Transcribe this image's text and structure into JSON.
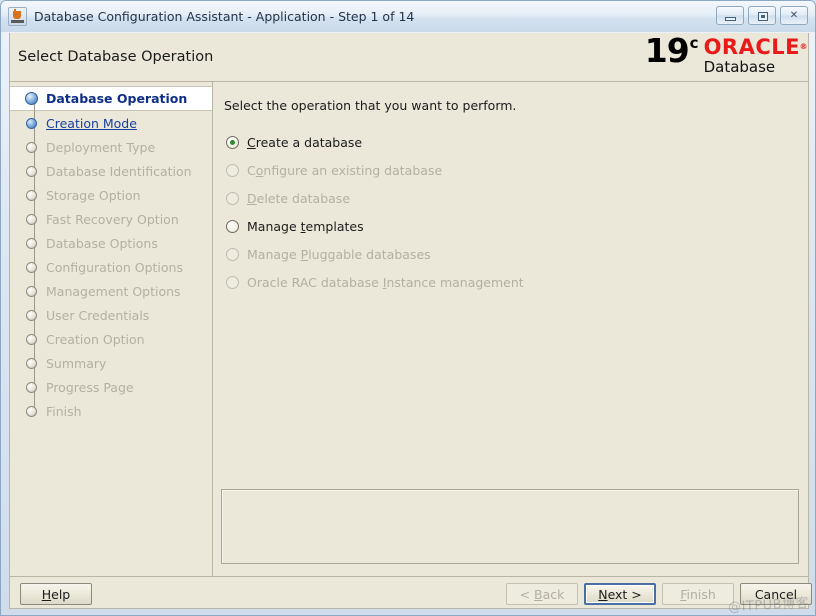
{
  "window": {
    "title": "Database Configuration Assistant - Application - Step 1 of 14",
    "icon": "java-app-icon",
    "buttons": {
      "minimize": "minimize-button",
      "maximize": "maximize-button",
      "close": "✕"
    }
  },
  "header": {
    "title": "Select Database Operation",
    "logo": {
      "version": "19",
      "version_suffix": "c",
      "brand": "ORACLE",
      "product": "Database",
      "brand_color": "#e81a1a"
    }
  },
  "sidebar": {
    "items": [
      {
        "label": "Database Operation",
        "state": "active"
      },
      {
        "label": "Creation Mode",
        "state": "visited"
      },
      {
        "label": "Deployment Type",
        "state": "disabled"
      },
      {
        "label": "Database Identification",
        "state": "disabled"
      },
      {
        "label": "Storage Option",
        "state": "disabled"
      },
      {
        "label": "Fast Recovery Option",
        "state": "disabled"
      },
      {
        "label": "Database Options",
        "state": "disabled"
      },
      {
        "label": "Configuration Options",
        "state": "disabled"
      },
      {
        "label": "Management Options",
        "state": "disabled"
      },
      {
        "label": "User Credentials",
        "state": "disabled"
      },
      {
        "label": "Creation Option",
        "state": "disabled"
      },
      {
        "label": "Summary",
        "state": "disabled"
      },
      {
        "label": "Progress Page",
        "state": "disabled"
      },
      {
        "label": "Finish",
        "state": "disabled"
      }
    ]
  },
  "main": {
    "instruction": "Select the operation that you want to perform.",
    "options": [
      {
        "label": "Create a database",
        "pre": "",
        "mnemonic": "C",
        "post": "reate a database",
        "selected": true,
        "disabled": false
      },
      {
        "label": "Configure an existing database",
        "pre": "C",
        "mnemonic": "o",
        "post": "nfigure an existing database",
        "selected": false,
        "disabled": true
      },
      {
        "label": "Delete database",
        "pre": "",
        "mnemonic": "D",
        "post": "elete database",
        "selected": false,
        "disabled": true
      },
      {
        "label": "Manage templates",
        "pre": "Manage ",
        "mnemonic": "t",
        "post": "emplates",
        "selected": false,
        "disabled": false
      },
      {
        "label": "Manage Pluggable databases",
        "pre": "Manage ",
        "mnemonic": "P",
        "post": "luggable databases",
        "selected": false,
        "disabled": true
      },
      {
        "label": "Oracle RAC database Instance management",
        "pre": "Oracle RAC database ",
        "mnemonic": "I",
        "post": "nstance management",
        "selected": false,
        "disabled": true
      }
    ],
    "message_panel": ""
  },
  "footer": {
    "buttons": [
      {
        "id": "help",
        "label": "Help",
        "pre": "",
        "mnemonic": "H",
        "post": "elp",
        "disabled": false,
        "focused": false
      },
      {
        "id": "back",
        "label": "< Back",
        "pre": "< ",
        "mnemonic": "B",
        "post": "ack",
        "disabled": true,
        "focused": false
      },
      {
        "id": "next",
        "label": "Next >",
        "pre": "",
        "mnemonic": "N",
        "post": "ext >",
        "disabled": false,
        "focused": true
      },
      {
        "id": "finish",
        "label": "Finish",
        "pre": "",
        "mnemonic": "F",
        "post": "inish",
        "disabled": true,
        "focused": false
      },
      {
        "id": "cancel",
        "label": "Cancel",
        "pre": "",
        "mnemonic": "",
        "post": "Cancel",
        "disabled": false,
        "focused": false
      }
    ]
  },
  "watermark": "@ITPUB博客"
}
